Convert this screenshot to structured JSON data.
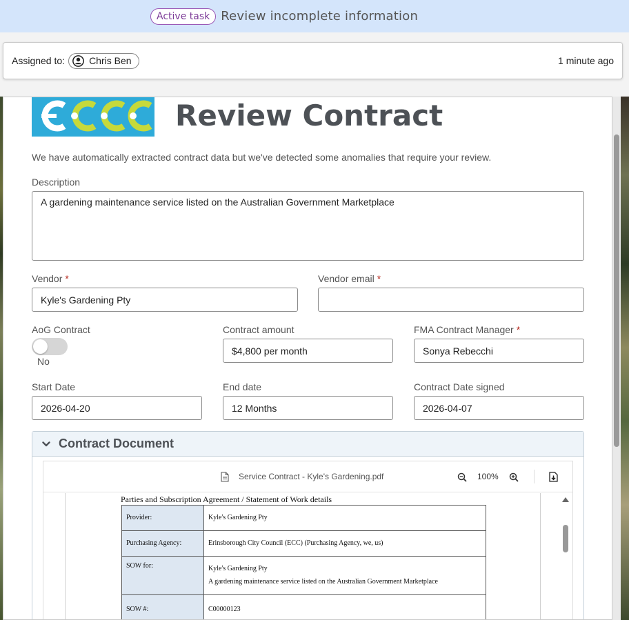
{
  "task": {
    "badge": "Active task",
    "title": "Review incomplete information"
  },
  "assignment": {
    "label": "Assigned to:",
    "user": "Chris Ben",
    "time": "1 minute ago"
  },
  "form": {
    "title": "Review Contract",
    "intro": "We have automatically extracted contract data but we've detected some anomalies that require your review.",
    "description": {
      "label": "Description",
      "value": "A gardening maintenance service listed on the Australian Government Marketplace"
    },
    "vendor": {
      "label": "Vendor",
      "required": "*",
      "value": "Kyle's Gardening Pty"
    },
    "vendor_email": {
      "label": "Vendor email",
      "required": "*",
      "value": ""
    },
    "aog": {
      "label": "AoG Contract",
      "state": "No"
    },
    "contract_amount": {
      "label": "Contract amount",
      "value": "$4,800 per month"
    },
    "fma_manager": {
      "label": "FMA Contract Manager",
      "required": "*",
      "value": "Sonya Rebecchi"
    },
    "start_date": {
      "label": "Start Date",
      "value": "2026-04-20"
    },
    "end_date": {
      "label": "End date",
      "value": "12 Months"
    },
    "date_signed": {
      "label": "Contract Date signed",
      "value": "2026-04-07"
    }
  },
  "document": {
    "section_title": "Contract Document",
    "file_name": "Service Contract - Kyle's Gardening.pdf",
    "zoom": "100%",
    "pdf": {
      "heading": "Parties and Subscription Agreement / Statement of Work details",
      "rows": [
        {
          "key": "Provider:",
          "value": "Kyle's Gardening Pty",
          "value2": ""
        },
        {
          "key": "Purchasing Agency:",
          "value": "Erinsborough City Council (ECC) (Purchasing Agency, we, us)",
          "value2": ""
        },
        {
          "key": "SOW for:",
          "value": "Kyle's Gardening Pty",
          "value2": "A gardening maintenance service listed on the Australian Government Marketplace"
        },
        {
          "key": "SOW #:",
          "value": "C00000123",
          "value2": ""
        }
      ]
    }
  },
  "colors": {
    "task_bar": "#d4e5fb",
    "badge_border": "#9b59b6",
    "logo_bg": "#2eabd9",
    "logo_green": "#c6d93b",
    "required": "#b42318"
  }
}
